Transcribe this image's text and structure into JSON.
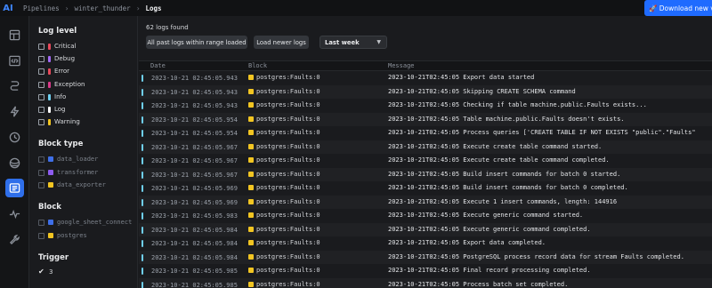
{
  "topbar": {
    "logo": "AI",
    "breadcrumbs": [
      "Pipelines",
      "winter_thunder",
      "Logs"
    ],
    "download_label": "🚀 Download new ver"
  },
  "rail": {
    "items": [
      "pipeline-overview-icon",
      "code-icon",
      "triggers-icon",
      "lightning-icon",
      "clock-icon",
      "globe-icon",
      "logs-icon",
      "monitor-icon",
      "settings-icon"
    ],
    "active": "logs-icon"
  },
  "filters": {
    "log_level_title": "Log level",
    "levels": [
      {
        "label": "Critical",
        "color": "#e8495b"
      },
      {
        "label": "Debug",
        "color": "#a36af5"
      },
      {
        "label": "Error",
        "color": "#e8495b"
      },
      {
        "label": "Exception",
        "color": "#d9398a"
      },
      {
        "label": "Info",
        "color": "#6fd0f0"
      },
      {
        "label": "Log",
        "color": "#ffffff"
      },
      {
        "label": "Warning",
        "color": "#f2c522"
      }
    ],
    "block_type_title": "Block type",
    "block_types": [
      {
        "label": "data_loader",
        "color": "#3f6fe8"
      },
      {
        "label": "transformer",
        "color": "#8e5cf0"
      },
      {
        "label": "data_exporter",
        "color": "#f2c522"
      }
    ],
    "block_title": "Block",
    "blocks": [
      {
        "label": "google_sheet_connect",
        "color": "#3f6fe8"
      },
      {
        "label": "postgres",
        "color": "#f2c522"
      }
    ],
    "trigger_title": "Trigger",
    "triggers": [
      {
        "label": "3",
        "checked": true
      }
    ]
  },
  "main": {
    "count_text": "62 logs found",
    "btn_past": "All past logs within range loaded",
    "btn_newer": "Load newer logs",
    "range_select": "Last week",
    "columns": [
      "Date",
      "Block",
      "Message"
    ],
    "rows": [
      {
        "date": "2023-10-21 02:45:05.943",
        "block": "postgres:Faults:0",
        "message": "2023-10-21T02:45:05 Export data started"
      },
      {
        "date": "2023-10-21 02:45:05.943",
        "block": "postgres:Faults:0",
        "message": "2023-10-21T02:45:05 Skipping CREATE SCHEMA command"
      },
      {
        "date": "2023-10-21 02:45:05.943",
        "block": "postgres:Faults:0",
        "message": "2023-10-21T02:45:05 Checking if table machine.public.Faults exists..."
      },
      {
        "date": "2023-10-21 02:45:05.954",
        "block": "postgres:Faults:0",
        "message": "2023-10-21T02:45:05 Table machine.public.Faults doesn't exists."
      },
      {
        "date": "2023-10-21 02:45:05.954",
        "block": "postgres:Faults:0",
        "message": "2023-10-21T02:45:05 Process queries ['CREATE TABLE IF NOT EXISTS \"public\".\"Faults\""
      },
      {
        "date": "2023-10-21 02:45:05.967",
        "block": "postgres:Faults:0",
        "message": "2023-10-21T02:45:05 Execute create table command started."
      },
      {
        "date": "2023-10-21 02:45:05.967",
        "block": "postgres:Faults:0",
        "message": "2023-10-21T02:45:05 Execute create table command completed."
      },
      {
        "date": "2023-10-21 02:45:05.967",
        "block": "postgres:Faults:0",
        "message": "2023-10-21T02:45:05 Build insert commands for batch 0 started."
      },
      {
        "date": "2023-10-21 02:45:05.969",
        "block": "postgres:Faults:0",
        "message": "2023-10-21T02:45:05 Build insert commands for batch 0 completed."
      },
      {
        "date": "2023-10-21 02:45:05.969",
        "block": "postgres:Faults:0",
        "message": "2023-10-21T02:45:05 Execute 1 insert commands, length: 144916"
      },
      {
        "date": "2023-10-21 02:45:05.983",
        "block": "postgres:Faults:0",
        "message": "2023-10-21T02:45:05 Execute generic command started."
      },
      {
        "date": "2023-10-21 02:45:05.984",
        "block": "postgres:Faults:0",
        "message": "2023-10-21T02:45:05 Execute generic command completed."
      },
      {
        "date": "2023-10-21 02:45:05.984",
        "block": "postgres:Faults:0",
        "message": "2023-10-21T02:45:05 Export data completed."
      },
      {
        "date": "2023-10-21 02:45:05.984",
        "block": "postgres:Faults:0",
        "message": "2023-10-21T02:45:05 PostgreSQL process record data for stream Faults completed."
      },
      {
        "date": "2023-10-21 02:45:05.985",
        "block": "postgres:Faults:0",
        "message": "2023-10-21T02:45:05 Final record processing completed."
      },
      {
        "date": "2023-10-21 02:45:05.985",
        "block": "postgres:Faults:0",
        "message": "2023-10-21T02:45:05 Process batch set completed."
      }
    ]
  }
}
